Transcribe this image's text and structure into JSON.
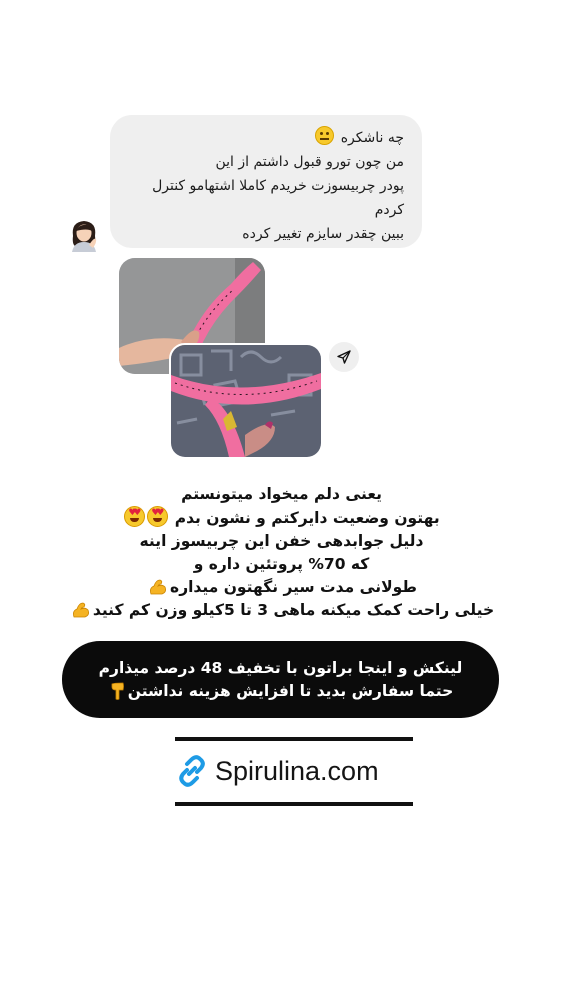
{
  "message": {
    "lines": [
      "چه ناشکره",
      "من چون تورو قبول داشتم از این",
      "پودر چربیسوزت خریدم کاملا اشتهامو کنترل",
      "کردم",
      "ببین چقدر سایزم تغییر کرده"
    ],
    "emoji": "neutral-face"
  },
  "story": {
    "lines": [
      "یعنی دلم میخواد میتونستم",
      "بهتون وضعیت دایرکتم و نشون بدم",
      "دلیل جوابدهی خفن این چربیسوز اینه",
      "که 70% پروتئین داره و",
      "طولانی مدت سیر نگهتون میداره",
      "خیلی راحت کمک میکنه ماهی 3 تا 5کیلو وزن کم کنید"
    ]
  },
  "banner": {
    "lines": [
      "لینکش و اینجا براتون با تخفیف 48 درصد میذارم",
      "حتما سفارش بدید تا افزایش هزینه نداشتن"
    ]
  },
  "link": {
    "text": "Spirulina.com",
    "icon": "link-icon",
    "color": "#1e9be5"
  },
  "colors": {
    "bubble": "#efefef",
    "banner": "#0b0b0b",
    "tape": "#f06ea0"
  }
}
